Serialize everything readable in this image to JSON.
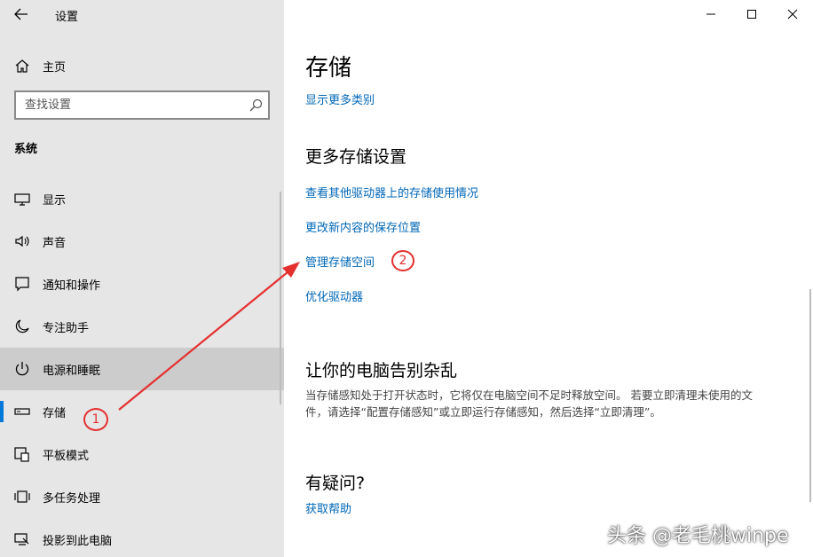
{
  "window": {
    "title": "设置",
    "controls": [
      "minimize-icon",
      "maximize-icon",
      "close-icon"
    ]
  },
  "sidebar": {
    "home_label": "主页",
    "search_placeholder": "查找设置",
    "section_title": "系统",
    "items": [
      {
        "label": "显示",
        "icon": "display-icon"
      },
      {
        "label": "声音",
        "icon": "sound-icon"
      },
      {
        "label": "通知和操作",
        "icon": "notification-icon"
      },
      {
        "label": "专注助手",
        "icon": "moon-icon"
      },
      {
        "label": "电源和睡眠",
        "icon": "power-icon",
        "state": "hover"
      },
      {
        "label": "存储",
        "icon": "storage-icon",
        "state": "selected"
      },
      {
        "label": "平板模式",
        "icon": "tablet-icon"
      },
      {
        "label": "多任务处理",
        "icon": "multitask-icon"
      },
      {
        "label": "投影到此电脑",
        "icon": "project-icon"
      }
    ]
  },
  "main": {
    "title": "存储",
    "show_more_link": "显示更多类别",
    "more_storage": {
      "heading": "更多存储设置",
      "links": [
        "查看其他驱动器上的存储使用情况",
        "更改新内容的保存位置",
        "管理存储空间",
        "优化驱动器"
      ]
    },
    "declutter": {
      "heading": "让你的电脑告别杂乱",
      "text": "当存储感知处于打开状态时，它将仅在电脑空间不足时释放空间。 若要立即清理未使用的文件，请选择“配置存储感知”或立即运行存储感知，然后选择“立即清理”。"
    },
    "question": {
      "heading": "有疑问?",
      "link": "获取帮助"
    }
  },
  "annotations": {
    "marker_1": "1",
    "marker_2": "2",
    "color": "#e53030"
  },
  "watermark": "头条 @老毛桃winpe",
  "colors": {
    "accent": "#0078d7",
    "link": "#0067b8",
    "sidebar_bg": "#e6e6e6"
  }
}
